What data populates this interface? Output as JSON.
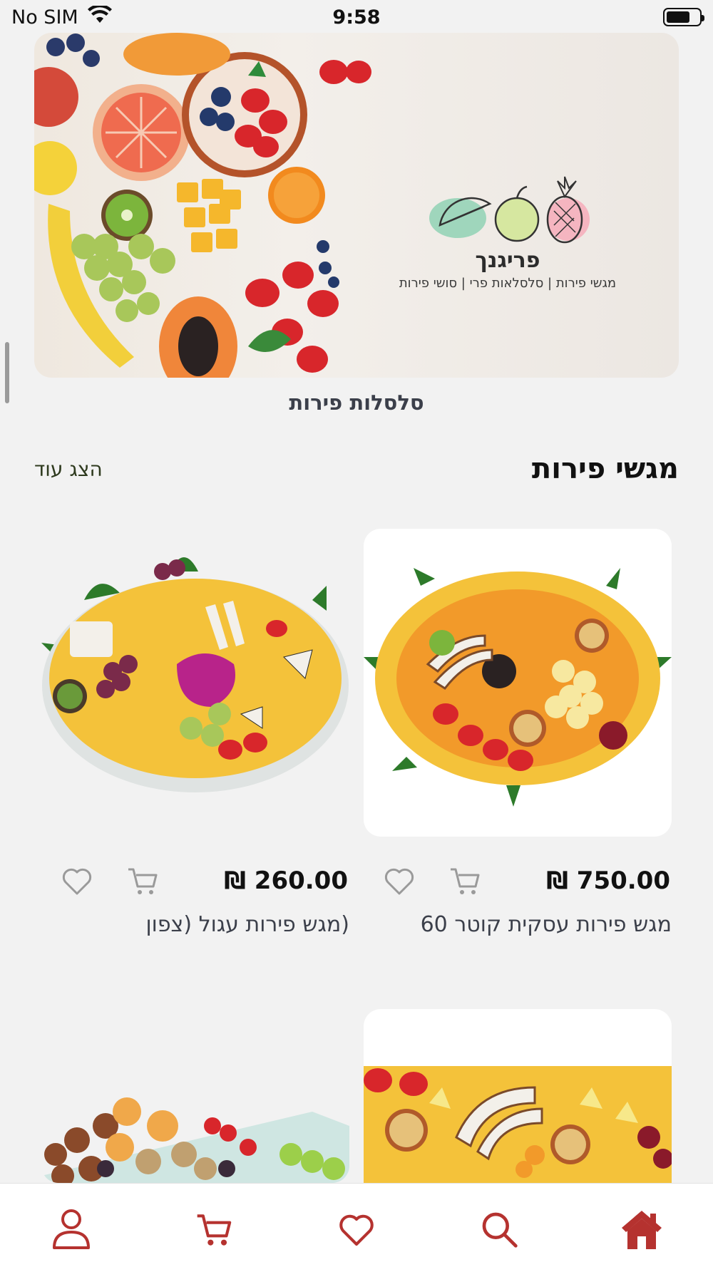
{
  "status_bar": {
    "carrier": "No SIM",
    "time": "9:58"
  },
  "hero": {
    "brand_name": "פריגנך",
    "tagline": "מגשי פירות | סלסלאות פרי | סושי פירות"
  },
  "banner_caption": "סלסלות פירות",
  "section": {
    "title": "מגשי פירות",
    "show_more": "הצג עוד"
  },
  "products": [
    {
      "name": "מגש פירות עסקית קוטר 60",
      "price": "₪ 750.00"
    },
    {
      "name": "(מגש פירות עגול (צפון",
      "price": "₪ 260.00"
    }
  ],
  "colors": {
    "accent": "#b5322f",
    "icon_gray": "#9a9a9a",
    "background": "#f2f2f2"
  },
  "icons": {
    "nav": [
      "home-icon",
      "search-icon",
      "heart-icon",
      "cart-icon",
      "user-icon"
    ],
    "card": [
      "heart-icon",
      "cart-icon"
    ]
  }
}
